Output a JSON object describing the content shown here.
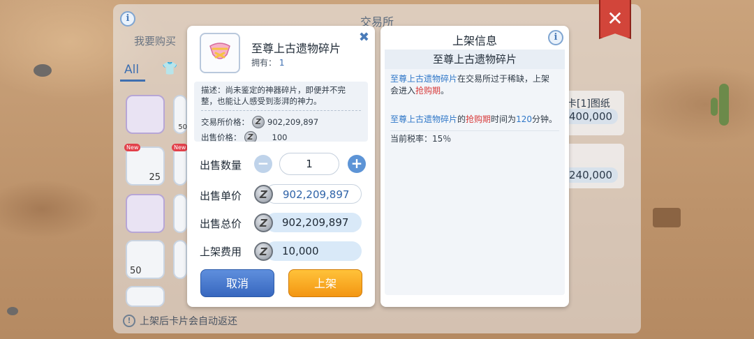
{
  "exchange": {
    "title": "交易所",
    "buy_tab": "我要购买",
    "all_tab": "All",
    "slot_counts": {
      "fifty_a": "50",
      "twentyfive": "25",
      "fifty_b": "50"
    },
    "new_badge": "New",
    "list_label_1": "卡[1]图纸",
    "list_price_1": "400,000",
    "list_price_2": "240,000",
    "bottom_note": "上架后卡片会自动返还",
    "close_icon": "close-x",
    "colors": {
      "close_ribbon": "#d2453a",
      "accent_blue": "#3e6fb0"
    }
  },
  "sell_dialog": {
    "item_name": "至尊上古遗物碎片",
    "own_label": "拥有：",
    "own_value": "1",
    "description": "描述：尚未鉴定的神器碎片，即便并不完整，也能让人感受到澎湃的神力。",
    "exchange_price_label": "交易所价格：",
    "exchange_price_value": "902,209,897",
    "sell_price_label": "出售价格：",
    "sell_price_value": "100",
    "quantity_label": "出售数量",
    "quantity_value": "1",
    "unit_price_label": "出售单价",
    "unit_price_value": "902,209,897",
    "total_price_label": "出售总价",
    "total_price_value": "902,209,897",
    "listing_fee_label": "上架费用",
    "listing_fee_value": "10,000",
    "coin_symbol": "Z",
    "cancel_label": "取消",
    "list_label": "上架"
  },
  "info_panel": {
    "title": "上架信息",
    "subtitle": "至尊上古遗物碎片",
    "line1_item": "至尊上古遗物碎片",
    "line1_text": "在交易所过于稀缺，上架会进入",
    "line1_tag": "抢购期",
    "line1_end": "。",
    "line2_item": "至尊上古遗物碎片",
    "line2_text_a": "的",
    "line2_tag": "抢购期",
    "line2_text_b": "时间为",
    "line2_minutes": "120",
    "line2_text_c": "分钟。",
    "tax_label": "当前税率：",
    "tax_value": "15％"
  }
}
